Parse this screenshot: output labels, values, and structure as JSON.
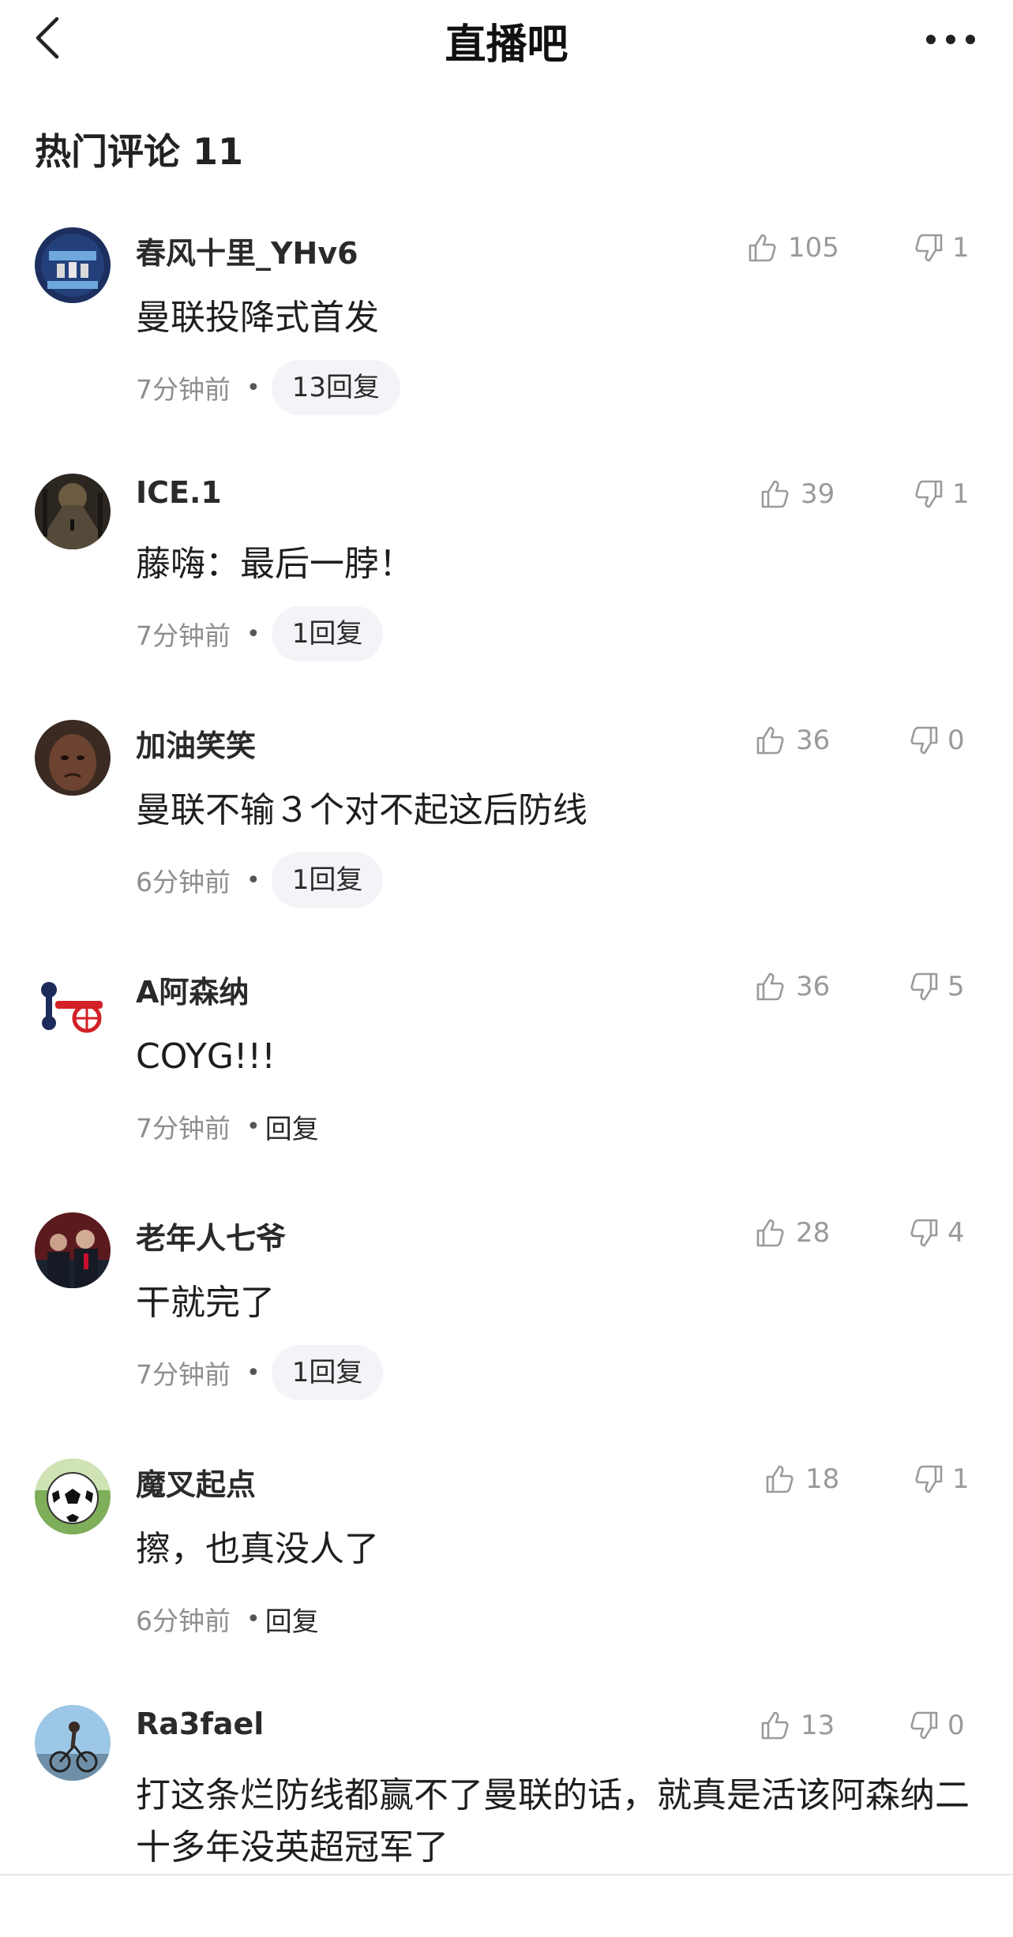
{
  "header": {
    "title": "直播吧"
  },
  "section": {
    "title": "热门评论 11"
  },
  "comments": [
    {
      "username": "春风十里_YHv6",
      "content": "曼联投降式首发",
      "time": "7分钟前",
      "likes": "105",
      "dislikes": "1",
      "reply": "13回复",
      "reply_style": "pill",
      "avatar_icon": "treble-winners-avatar"
    },
    {
      "username": "ICE.1",
      "content": "藤嗨：最后一脖！",
      "time": "7分钟前",
      "likes": "39",
      "dislikes": "1",
      "reply": "1回复",
      "reply_style": "pill",
      "avatar_icon": "night-street-avatar"
    },
    {
      "username": "加油笑笑",
      "content": "曼联不输３个对不起这后防线",
      "time": "6分钟前",
      "likes": "36",
      "dislikes": "0",
      "reply": "1回复",
      "reply_style": "pill",
      "avatar_icon": "child-face-avatar"
    },
    {
      "username": "A阿森纳",
      "content": "COYG!!!",
      "time": "7分钟前",
      "likes": "36",
      "dislikes": "5",
      "reply": "回复",
      "reply_style": "plain",
      "avatar_icon": "cannon-avatar"
    },
    {
      "username": "老年人七爷",
      "content": "干就完了",
      "time": "7分钟前",
      "likes": "28",
      "dislikes": "4",
      "reply": "1回复",
      "reply_style": "pill",
      "avatar_icon": "stadium-people-avatar"
    },
    {
      "username": "魔叉起点",
      "content": "擦，也真没人了",
      "time": "6分钟前",
      "likes": "18",
      "dislikes": "1",
      "reply": "回复",
      "reply_style": "plain",
      "avatar_icon": "football-avatar"
    },
    {
      "username": "Ra3fael",
      "content": "打这条烂防线都赢不了曼联的话，就真是活该阿森纳二十多年没英超冠军了",
      "time": "",
      "likes": "13",
      "dislikes": "0",
      "reply": "",
      "reply_style": "none",
      "avatar_icon": "cyclist-avatar"
    }
  ]
}
